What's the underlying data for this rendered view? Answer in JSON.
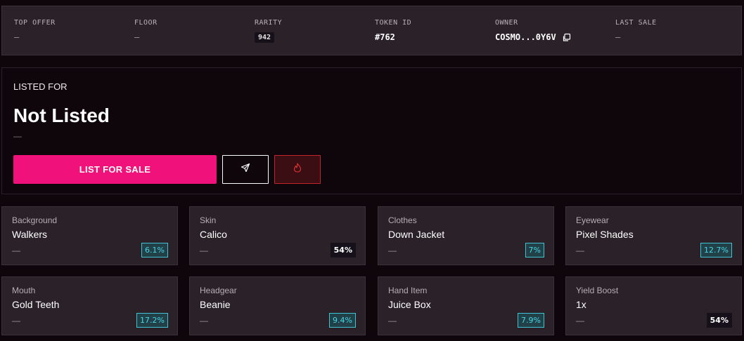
{
  "stats": [
    {
      "label": "TOP OFFER",
      "value": "—"
    },
    {
      "label": "FLOOR",
      "value": "—"
    },
    {
      "label": "RARITY",
      "value": "942"
    },
    {
      "label": "TOKEN ID",
      "value": "#762"
    },
    {
      "label": "OWNER",
      "value": "COSMO...0Y6V"
    },
    {
      "label": "LAST SALE",
      "value": "—"
    }
  ],
  "listing": {
    "label": "LISTED FOR",
    "title": "Not Listed",
    "sub": "—",
    "list_button": "LIST FOR SALE",
    "send_icon": "send-icon",
    "burn_icon": "flame-icon"
  },
  "traits": [
    {
      "type": "Background",
      "value": "Walkers",
      "dash": "—",
      "pct": "6.1%",
      "style": "cyan"
    },
    {
      "type": "Skin",
      "value": "Calico",
      "dash": "—",
      "pct": "54%",
      "style": "dark"
    },
    {
      "type": "Clothes",
      "value": "Down Jacket",
      "dash": "—",
      "pct": "7%",
      "style": "cyan"
    },
    {
      "type": "Eyewear",
      "value": "Pixel Shades",
      "dash": "—",
      "pct": "12.7%",
      "style": "cyan"
    },
    {
      "type": "Mouth",
      "value": "Gold Teeth",
      "dash": "—",
      "pct": "17.2%",
      "style": "cyan"
    },
    {
      "type": "Headgear",
      "value": "Beanie",
      "dash": "—",
      "pct": "9.4%",
      "style": "cyan"
    },
    {
      "type": "Hand Item",
      "value": "Juice Box",
      "dash": "—",
      "pct": "7.9%",
      "style": "cyan"
    },
    {
      "type": "Yield Boost",
      "value": "1x",
      "dash": "—",
      "pct": "54%",
      "style": "dark"
    }
  ],
  "colors": {
    "accent": "#f0127a",
    "burn": "#c0262c",
    "rarity_cyan": "#48d7e6"
  }
}
